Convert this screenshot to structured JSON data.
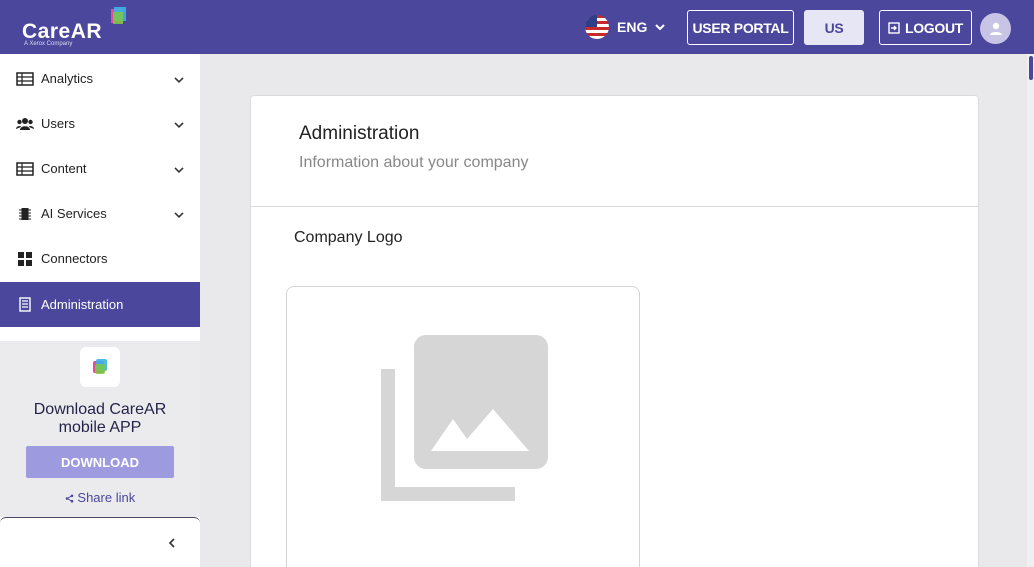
{
  "header": {
    "logo_text": "CareAR",
    "logo_tm": "™",
    "logo_subtitle": "A Xerox Company",
    "language": "ENG",
    "user_portal_label": "USER PORTAL",
    "region_label": "US",
    "logout_label": "LOGOUT"
  },
  "sidebar": {
    "items": [
      {
        "label": "Analytics",
        "icon": "table-icon"
      },
      {
        "label": "Users",
        "icon": "users-icon"
      },
      {
        "label": "Content",
        "icon": "table-icon"
      },
      {
        "label": "AI Services",
        "icon": "chip-icon"
      },
      {
        "label": "Connectors",
        "icon": "grid-icon"
      },
      {
        "label": "Administration",
        "icon": "document-icon"
      }
    ],
    "promo": {
      "title_line1": "Download CareAR",
      "title_line2": "mobile APP",
      "download_label": "DOWNLOAD",
      "share_label": "Share link"
    }
  },
  "main": {
    "title": "Administration",
    "subtitle": "Information about your company",
    "section_title": "Company Logo"
  },
  "colors": {
    "brand": "#4a479c",
    "download_button": "#9e9ae0"
  }
}
